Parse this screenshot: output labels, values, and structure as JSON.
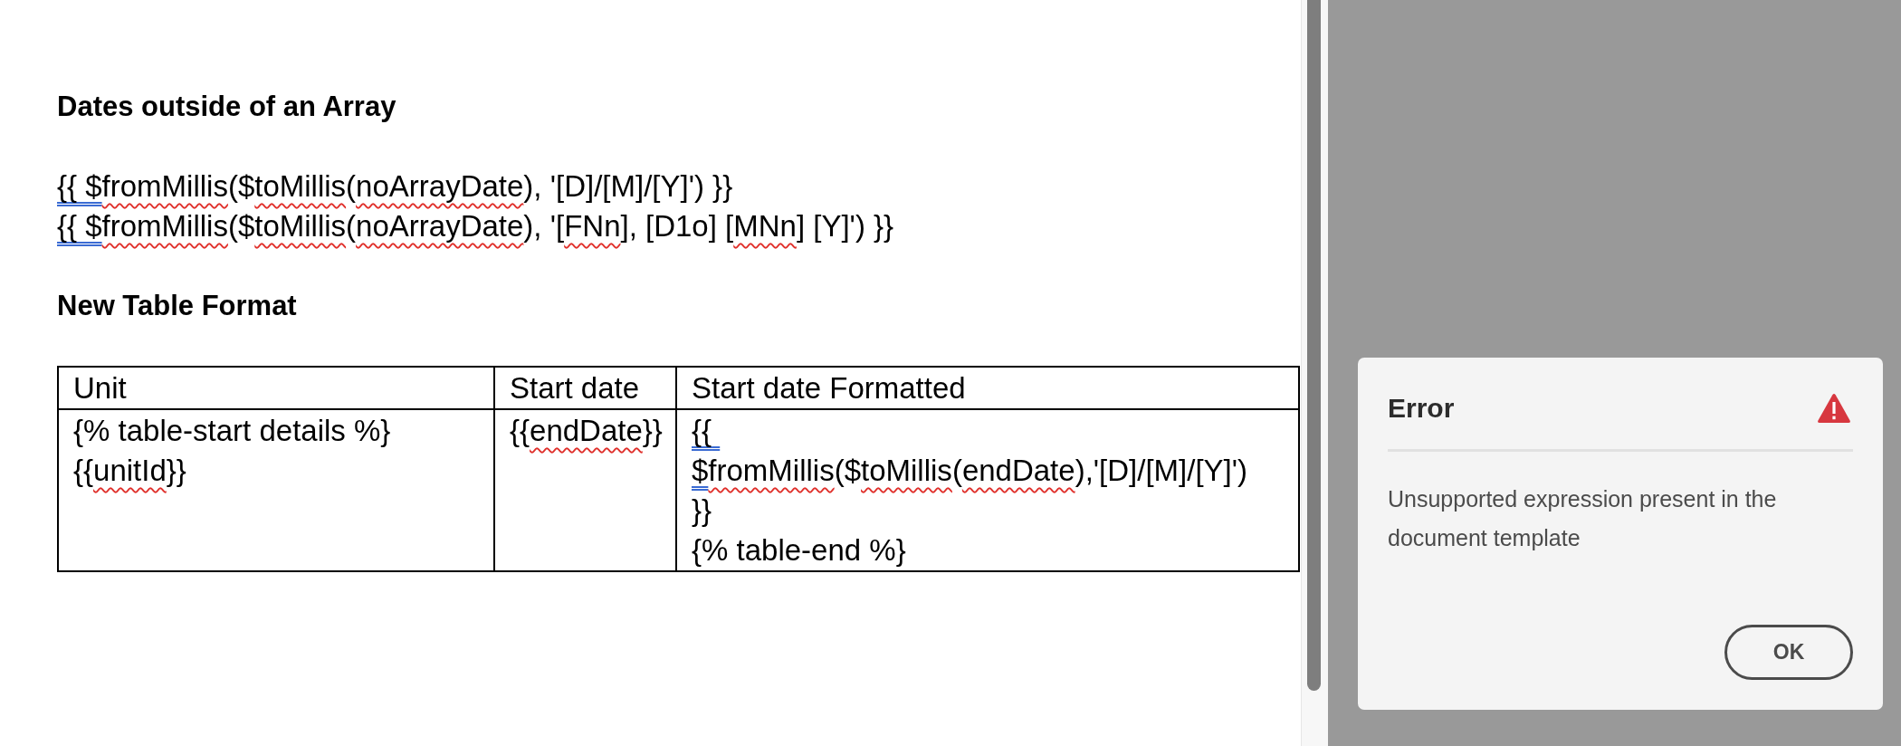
{
  "document": {
    "blocks": [
      {
        "kind": "heading",
        "text": "Dates outside of an Array"
      },
      {
        "kind": "paragraph",
        "segments": [
          {
            "text": "{{ $",
            "kind": "grammar"
          },
          {
            "text": "fromMillis",
            "kind": "misspelled"
          },
          {
            "text": "($",
            "kind": "plain"
          },
          {
            "text": "toMillis",
            "kind": "misspelled"
          },
          {
            "text": "(",
            "kind": "plain"
          },
          {
            "text": "noArrayDate",
            "kind": "misspelled"
          },
          {
            "text": "), '[D]/[M]/[Y]') }}",
            "kind": "plain"
          }
        ]
      },
      {
        "kind": "paragraph",
        "segments": [
          {
            "text": "{{ $",
            "kind": "grammar"
          },
          {
            "text": "fromMillis",
            "kind": "misspelled"
          },
          {
            "text": "($",
            "kind": "plain"
          },
          {
            "text": "toMillis",
            "kind": "misspelled"
          },
          {
            "text": "(",
            "kind": "plain"
          },
          {
            "text": "noArrayDate",
            "kind": "misspelled"
          },
          {
            "text": "), '[",
            "kind": "plain"
          },
          {
            "text": "FNn",
            "kind": "misspelled"
          },
          {
            "text": "], [D1o] [",
            "kind": "plain"
          },
          {
            "text": "MNn",
            "kind": "misspelled"
          },
          {
            "text": "] [Y]') }}",
            "kind": "plain"
          }
        ]
      },
      {
        "kind": "heading",
        "text": "New Table Format"
      },
      {
        "kind": "table",
        "columns": [
          "Unit",
          "Start date",
          "Start date Formatted"
        ],
        "rows": [
          {
            "cells": [
              {
                "paragraphs": [
                  {
                    "segments": [
                      {
                        "text": "{% table-start details %}",
                        "kind": "plain"
                      }
                    ]
                  },
                  {
                    "segments": [
                      {
                        "text": "{{",
                        "kind": "plain"
                      },
                      {
                        "text": "unitId",
                        "kind": "misspelled"
                      },
                      {
                        "text": "}}",
                        "kind": "plain"
                      }
                    ]
                  }
                ]
              },
              {
                "paragraphs": [
                  {
                    "segments": [
                      {
                        "text": "{{",
                        "kind": "plain"
                      },
                      {
                        "text": "endDate",
                        "kind": "misspelled"
                      },
                      {
                        "text": "}}",
                        "kind": "plain"
                      }
                    ]
                  }
                ]
              },
              {
                "paragraphs": [
                  {
                    "segments": [
                      {
                        "text": "{{ $",
                        "kind": "grammar"
                      },
                      {
                        "text": "fromMillis",
                        "kind": "misspelled"
                      },
                      {
                        "text": "($",
                        "kind": "plain"
                      },
                      {
                        "text": "toMillis",
                        "kind": "misspelled"
                      },
                      {
                        "text": "(",
                        "kind": "plain"
                      },
                      {
                        "text": "endDate",
                        "kind": "misspelled"
                      },
                      {
                        "text": "),'[D]/[M]/[Y]') }}",
                        "kind": "plain"
                      }
                    ]
                  },
                  {
                    "segments": [
                      {
                        "text": "{% table-end %}",
                        "kind": "plain"
                      }
                    ]
                  }
                ]
              }
            ]
          }
        ]
      }
    ]
  },
  "dialog": {
    "title": "Error",
    "message": "Unsupported expression present in the document template",
    "buttons": [
      "OK"
    ]
  }
}
